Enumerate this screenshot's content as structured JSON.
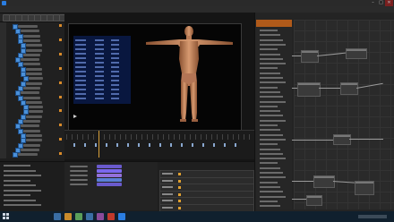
{
  "window": {
    "title": "",
    "right_title": "",
    "buttons": [
      "–",
      "□",
      "✕"
    ]
  },
  "menu": [],
  "viewport": {
    "caption": "",
    "play_icon": "play-icon"
  },
  "icons": {
    "app_logo": "app-logo-icon",
    "minimize": "minimize-icon",
    "maximize": "maximize-icon",
    "close": "close-icon",
    "start": "windows-start-icon"
  },
  "colors": {
    "accent_blue": "#4a90d9",
    "accent_orange": "#d9a13a",
    "info_panel": "#0a1b4a",
    "node_editor_bg": "#2a2a2a",
    "taskbar": "#10202e",
    "skin": "#c98a62"
  }
}
